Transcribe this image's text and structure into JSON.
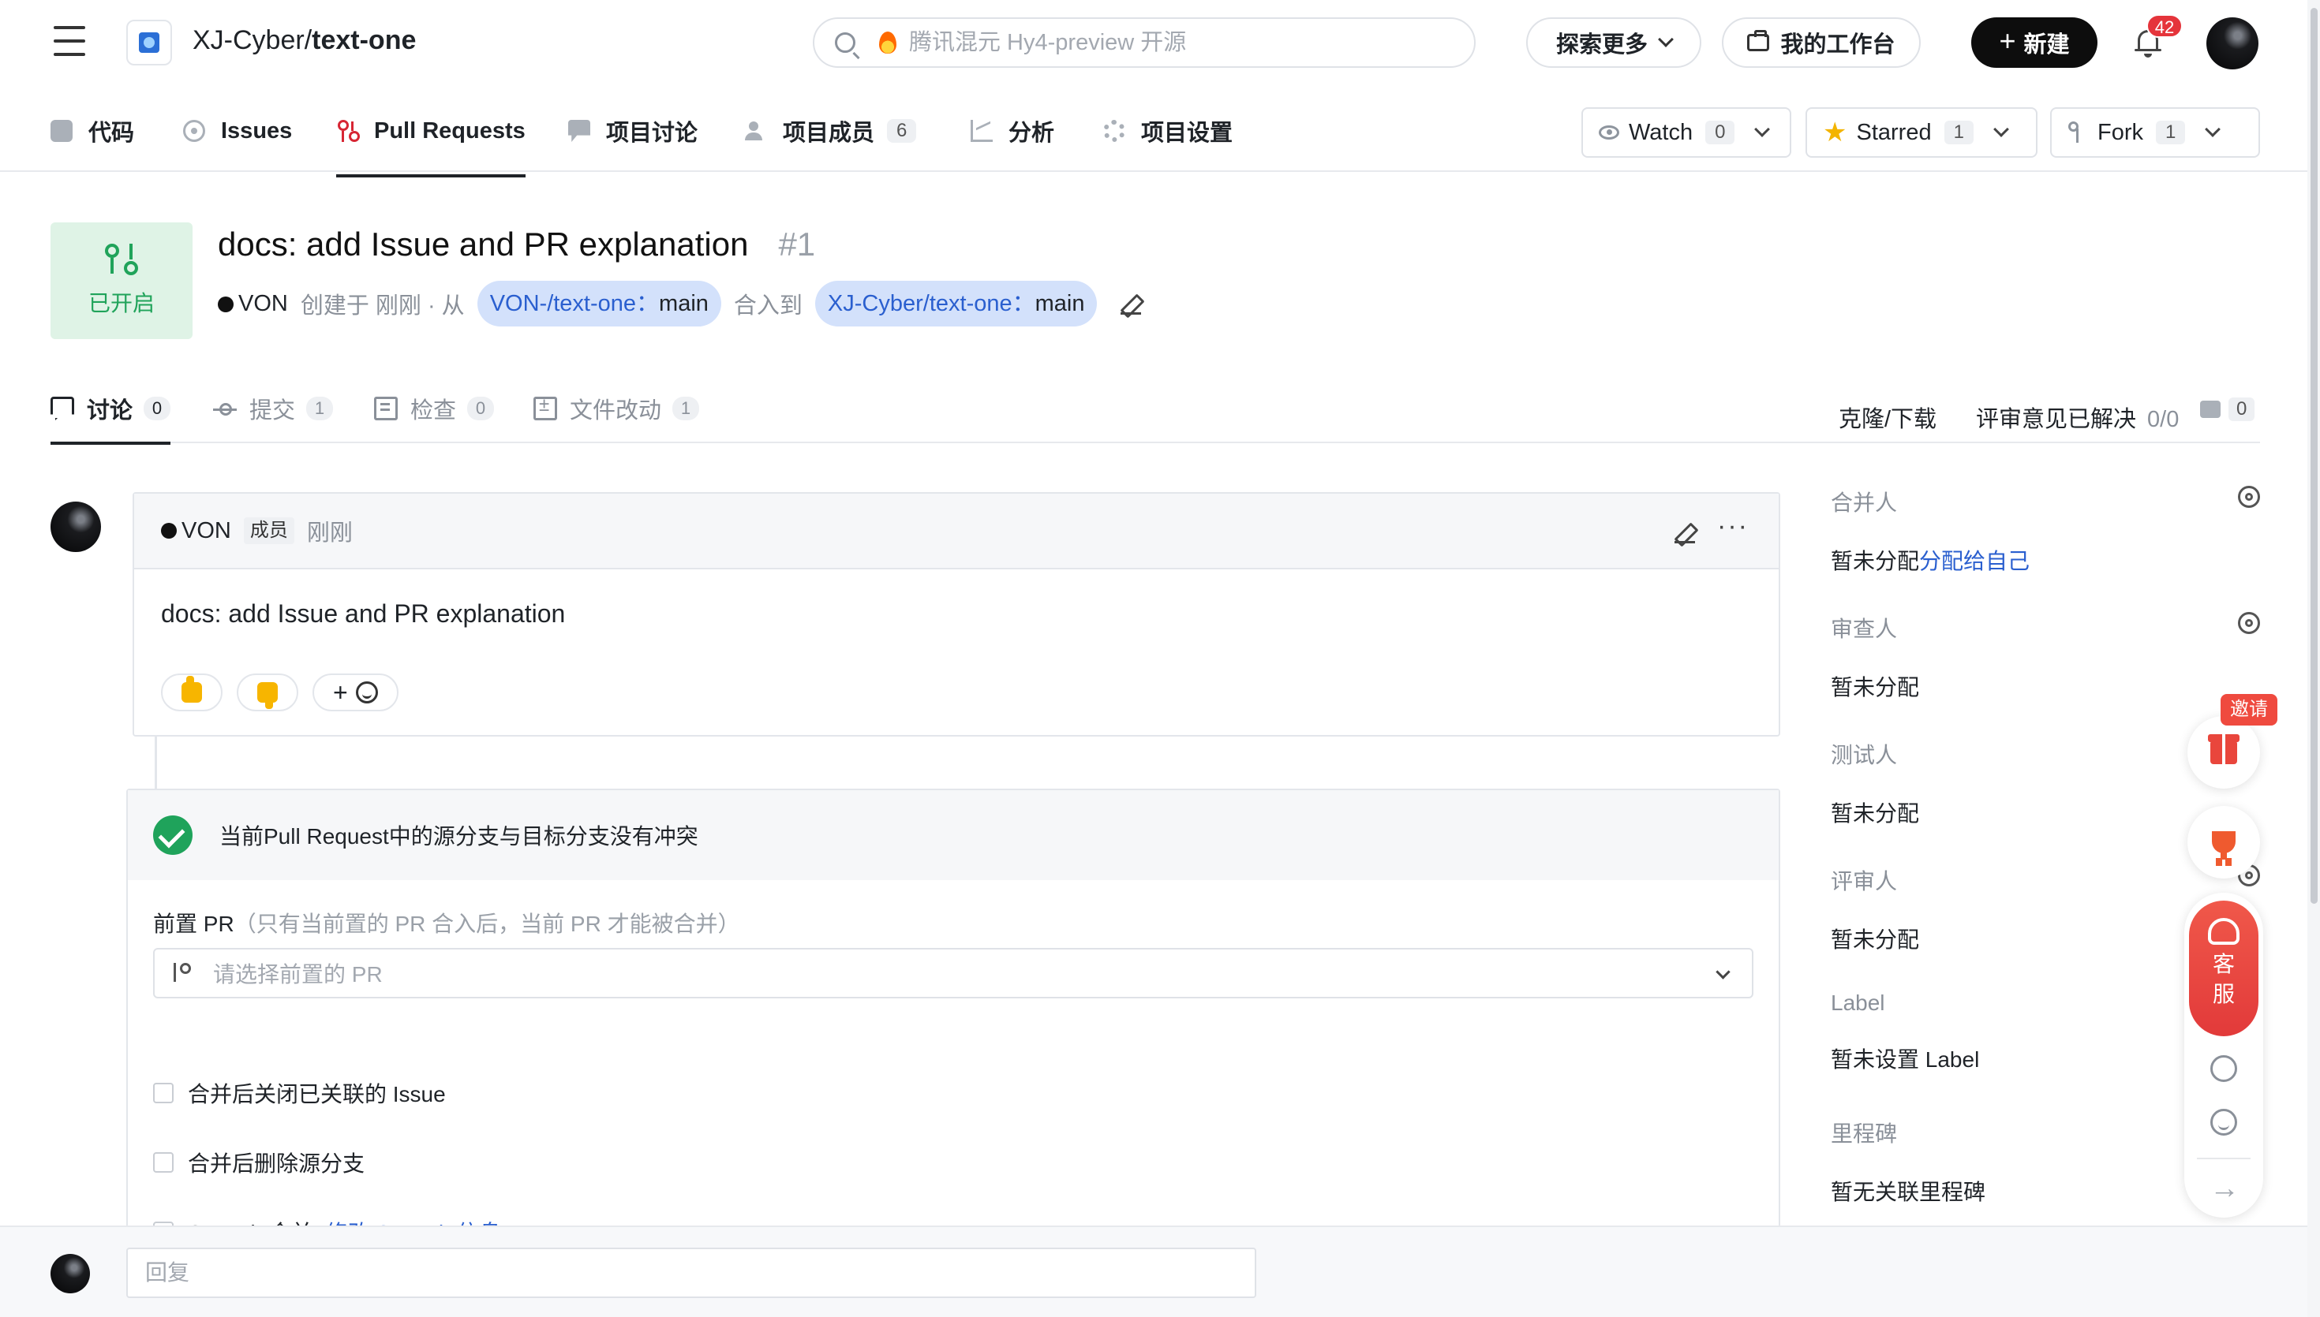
{
  "header": {
    "repo_owner": "XJ-Cyber/",
    "repo_name": "text-one",
    "search_placeholder": "腾讯混元 Hy4-preview 开源",
    "explore_label": "探索更多",
    "workbench_label": "我的工作台",
    "new_label": "新建",
    "notification_count": "42"
  },
  "repo_nav": {
    "items": [
      {
        "label": "代码",
        "icon": "code-icon"
      },
      {
        "label": "Issues",
        "icon": "issue-icon"
      },
      {
        "label": "Pull Requests",
        "icon": "pull-request-icon",
        "active": true
      },
      {
        "label": "项目讨论",
        "icon": "discussion-icon"
      },
      {
        "label": "项目成员",
        "icon": "members-icon",
        "count": "6"
      },
      {
        "label": "分析",
        "icon": "chart-icon"
      },
      {
        "label": "项目设置",
        "icon": "gear-icon"
      }
    ],
    "watch": {
      "label": "Watch",
      "count": "0"
    },
    "star": {
      "label": "Starred",
      "count": "1"
    },
    "fork": {
      "label": "Fork",
      "count": "1"
    }
  },
  "pr": {
    "state_label": "已开启",
    "title": "docs: add Issue and PR explanation",
    "number": "#1",
    "author": "VON",
    "created_text": "创建于 刚刚 · 从",
    "source_branch_repo": "VON-/text-one：",
    "source_branch": "main",
    "merge_into_text": "合入到",
    "target_branch_repo": "XJ-Cyber/text-one：",
    "target_branch": "main"
  },
  "pr_tabs": {
    "items": [
      {
        "label": "讨论",
        "count": "0",
        "active": true
      },
      {
        "label": "提交",
        "count": "1"
      },
      {
        "label": "检查",
        "count": "0"
      },
      {
        "label": "文件改动",
        "count": "1"
      }
    ],
    "clone_label": "克隆/下载",
    "review_resolved_label": "评审意见已解决",
    "review_resolved_value": "0/0",
    "comment_count": "0"
  },
  "comment": {
    "author": "VON",
    "role": "成员",
    "time": "刚刚",
    "body": "docs: add Issue and PR explanation",
    "add_reaction": "+"
  },
  "merge": {
    "status_text": "当前Pull Request中的源分支与目标分支没有冲突",
    "pre_pr_label": "前置 PR",
    "pre_pr_hint": "（只有当前置的 PR 合入后，当前 PR 才能被合并）",
    "pre_pr_placeholder": "请选择前置的 PR",
    "options": [
      {
        "label": "合并后关闭已关联的 Issue",
        "checked": false
      },
      {
        "label": "合并后删除源分支",
        "checked": false
      },
      {
        "label": "Squash 合并",
        "checked": false,
        "link": "修改 Squash 信息"
      }
    ]
  },
  "sidebar": {
    "sections": [
      {
        "title": "合并人",
        "value": "暂未分配",
        "link": "分配给自己",
        "gear": true
      },
      {
        "title": "审查人",
        "value": "暂未分配",
        "gear": true
      },
      {
        "title": "测试人",
        "value": "暂未分配"
      },
      {
        "title": "评审人",
        "value": "暂未分配",
        "gear": true
      },
      {
        "title": "Label",
        "value": "暂未设置 Label"
      },
      {
        "title": "里程碑",
        "value": "暂无关联里程碑"
      }
    ]
  },
  "floating": {
    "invite_label": "邀请",
    "support_label_1": "客",
    "support_label_2": "服"
  },
  "reply": {
    "placeholder": "回复"
  }
}
